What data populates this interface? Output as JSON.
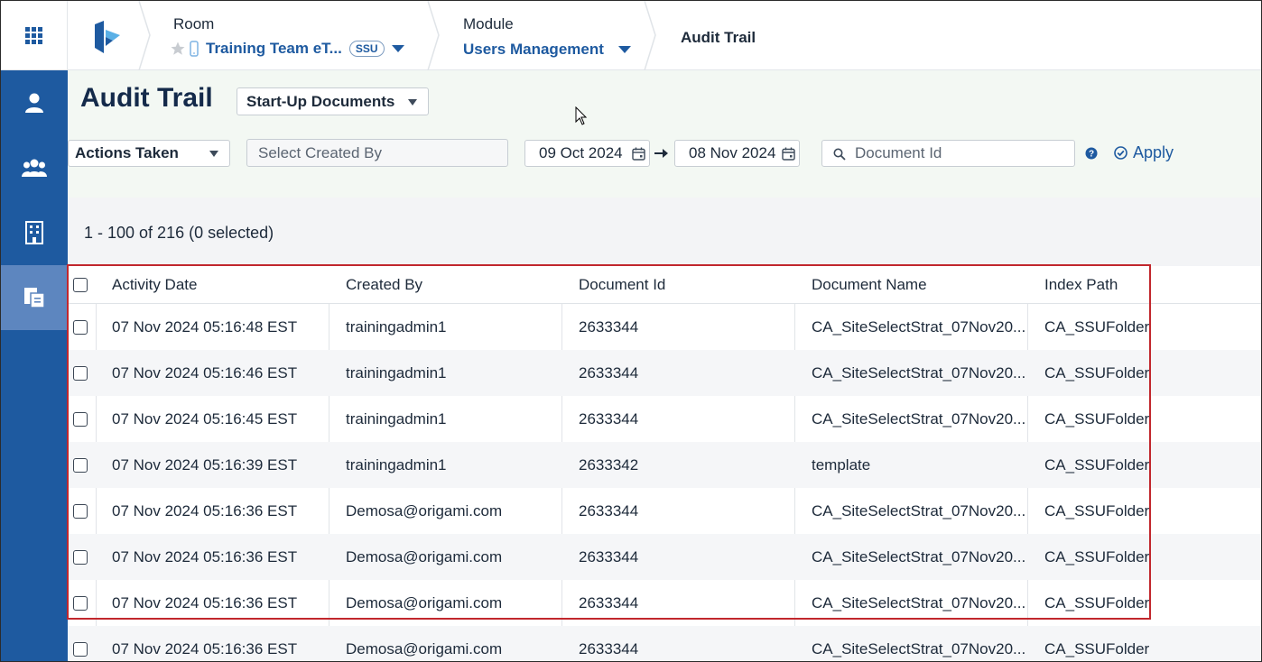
{
  "header": {
    "room": {
      "title": "Room",
      "value": "Training Team eT...",
      "badge": "SSU"
    },
    "module": {
      "title": "Module",
      "value": "Users Management"
    },
    "current": "Audit Trail"
  },
  "sidebar": {
    "items": [
      {
        "icon": "user-icon"
      },
      {
        "icon": "users-group-icon"
      },
      {
        "icon": "building-icon"
      },
      {
        "icon": "documents-icon",
        "active": true
      }
    ]
  },
  "page": {
    "title": "Audit Trail",
    "category_select": "Start-Up Documents"
  },
  "filters": {
    "actions_select": "Actions Taken",
    "created_by_placeholder": "Select Created By",
    "date_from": "09 Oct 2024",
    "date_to": "08 Nov 2024",
    "document_id_placeholder": "Document Id",
    "apply_label": "Apply"
  },
  "count": "1 - 100 of 216 (0 selected)",
  "table": {
    "headers": {
      "activity_date": "Activity Date",
      "created_by": "Created By",
      "document_id": "Document Id",
      "document_name": "Document Name",
      "index_path": "Index Path"
    },
    "rows": [
      {
        "date": "07 Nov 2024 05:16:48 EST",
        "by": "trainingadmin1",
        "id": "2633344",
        "name": "CA_SiteSelectStrat_07Nov20...",
        "path": "CA_SSUFolder"
      },
      {
        "date": "07 Nov 2024 05:16:46 EST",
        "by": "trainingadmin1",
        "id": "2633344",
        "name": "CA_SiteSelectStrat_07Nov20...",
        "path": "CA_SSUFolder"
      },
      {
        "date": "07 Nov 2024 05:16:45 EST",
        "by": "trainingadmin1",
        "id": "2633344",
        "name": "CA_SiteSelectStrat_07Nov20...",
        "path": "CA_SSUFolder"
      },
      {
        "date": "07 Nov 2024 05:16:39 EST",
        "by": "trainingadmin1",
        "id": "2633342",
        "name": "template",
        "path": "CA_SSUFolder"
      },
      {
        "date": "07 Nov 2024 05:16:36 EST",
        "by": "Demosa@origami.com",
        "id": "2633344",
        "name": "CA_SiteSelectStrat_07Nov20...",
        "path": "CA_SSUFolder"
      },
      {
        "date": "07 Nov 2024 05:16:36 EST",
        "by": "Demosa@origami.com",
        "id": "2633344",
        "name": "CA_SiteSelectStrat_07Nov20...",
        "path": "CA_SSUFolder"
      },
      {
        "date": "07 Nov 2024 05:16:36 EST",
        "by": "Demosa@origami.com",
        "id": "2633344",
        "name": "CA_SiteSelectStrat_07Nov20...",
        "path": "CA_SSUFolder"
      },
      {
        "date": "07 Nov 2024 05:16:36 EST",
        "by": "Demosa@origami.com",
        "id": "2633344",
        "name": "CA_SiteSelectStrat_07Nov20...",
        "path": "CA_SSUFolder"
      }
    ]
  },
  "colors": {
    "brand_blue": "#1e5aa0",
    "sidebar_active": "#5d86bf",
    "highlight_border": "#c1272d"
  }
}
